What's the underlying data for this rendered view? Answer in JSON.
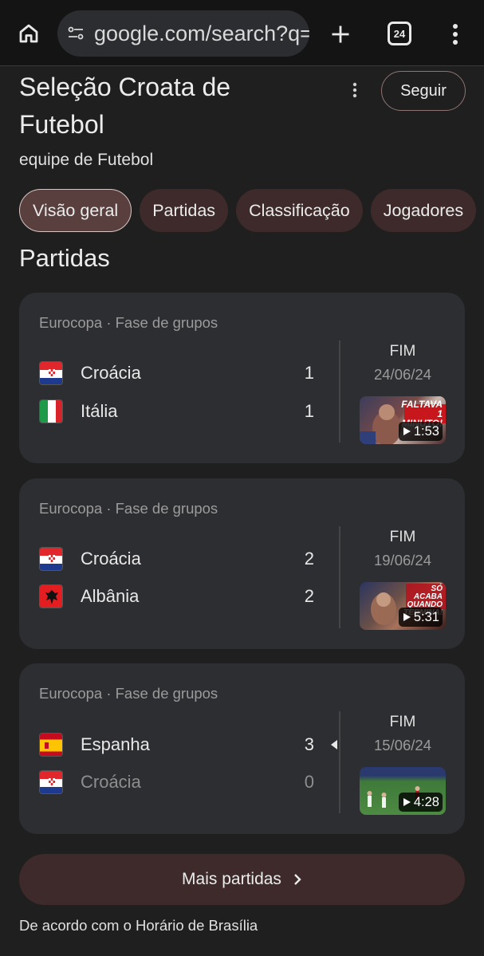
{
  "browser": {
    "url": "google.com/search?q=",
    "tab_count": "24",
    "icons": [
      "home-icon",
      "site-info-icon",
      "plus-icon",
      "tab-switcher-icon",
      "more-vert-icon"
    ]
  },
  "header": {
    "title": "Seleção Croata de Futebol",
    "subtitle": "equipe de Futebol",
    "follow_label": "Seguir"
  },
  "chips": [
    "Visão geral",
    "Partidas",
    "Classificação",
    "Jogadores"
  ],
  "section_title": "Partidas",
  "matches": [
    {
      "competition": "Eurocopa · Fase de grupos",
      "teams": [
        {
          "name": "Croácia",
          "score": "1",
          "flag": "croatia"
        },
        {
          "name": "Itália",
          "score": "1",
          "flag": "italy"
        }
      ],
      "status": "FIM",
      "date": "24/06/24",
      "video_duration": "1:53",
      "thumb_caption": "FALTAVA 1 MINUTO!"
    },
    {
      "competition": "Eurocopa · Fase de grupos",
      "teams": [
        {
          "name": "Croácia",
          "score": "2",
          "flag": "croatia"
        },
        {
          "name": "Albânia",
          "score": "2",
          "flag": "albania"
        }
      ],
      "status": "FIM",
      "date": "19/06/24",
      "video_duration": "5:31",
      "thumb_caption": "SÓ ACABA QUANDO TERMINA!"
    },
    {
      "competition": "Eurocopa · Fase de grupos",
      "teams": [
        {
          "name": "Espanha",
          "score": "3",
          "flag": "spain"
        },
        {
          "name": "Croácia",
          "score": "0",
          "flag": "croatia"
        }
      ],
      "status": "FIM",
      "date": "15/06/24",
      "video_duration": "4:28",
      "thumb_caption": ""
    }
  ],
  "more_button_label": "Mais partidas",
  "footer_note": "De acordo com o Horário de Brasília",
  "colors": {
    "background": "#1f1f1f",
    "card": "#2d2e31",
    "chip": "#3e2a2a",
    "chip_active": "#5a3f3f"
  }
}
